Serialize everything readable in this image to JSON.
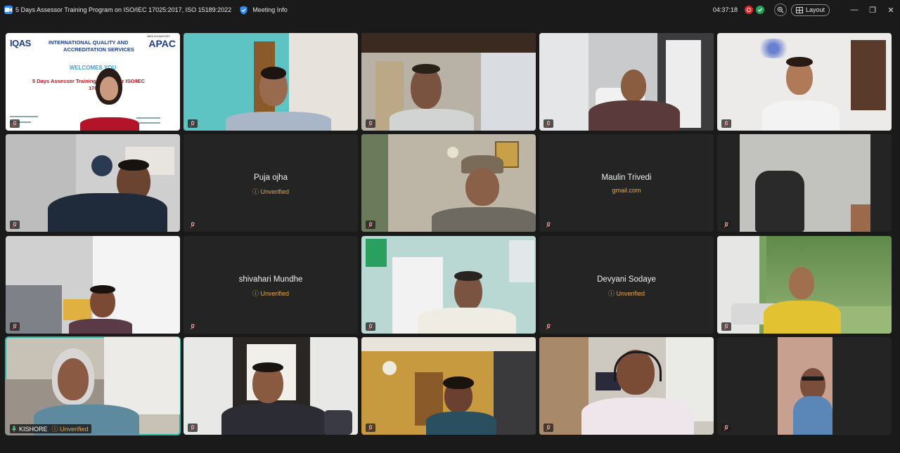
{
  "window": {
    "title": "5 Days Assessor Training Program  on ISO/IEC 17025:2017, ISO 15189:2022",
    "meeting_info": "Meeting Info",
    "timer": "04:37:18",
    "layout": "Layout",
    "minimize": "—",
    "restore": "❐",
    "close": "✕"
  },
  "slide": {
    "org_logo": "IQAS",
    "org_line1": "INTERNATIONAL QUALITY AND",
    "org_line2": "ACCREDITATION SERVICES",
    "badge_small": "MRA SIGNATORY",
    "badge_big": "APAC",
    "welcome": "WELCOMES YOU",
    "heading_line1": "5 Days Assessor Training P          per ISO/IEC",
    "heading_line2": "17025:2"
  },
  "participants": [
    {
      "id": "p1"
    },
    {
      "id": "p2"
    },
    {
      "id": "p3"
    },
    {
      "id": "p4"
    },
    {
      "id": "p5"
    },
    {
      "id": "p6"
    },
    {
      "id": "p7",
      "name": "Puja ojha",
      "status": "ⓘ Unverified"
    },
    {
      "id": "p8"
    },
    {
      "id": "p9",
      "name": "Maulin Trivedi",
      "status": "gmail.com"
    },
    {
      "id": "p10"
    },
    {
      "id": "p11"
    },
    {
      "id": "p12",
      "name": "shivahari Mundhe",
      "status": "ⓘ Unverified"
    },
    {
      "id": "p13"
    },
    {
      "id": "p14",
      "name": "Devyani Sodaye",
      "status": "ⓘ Unverified"
    },
    {
      "id": "p15"
    },
    {
      "id": "p16",
      "name": "KISHORE",
      "status": "ⓘ Unverified"
    },
    {
      "id": "p17"
    },
    {
      "id": "p18"
    },
    {
      "id": "p19"
    },
    {
      "id": "p20"
    }
  ],
  "colors": {
    "accent": "#2d8cff",
    "active_outline": "#2ab5a5",
    "unverified": "#f1a53b",
    "recording": "#e02828"
  }
}
